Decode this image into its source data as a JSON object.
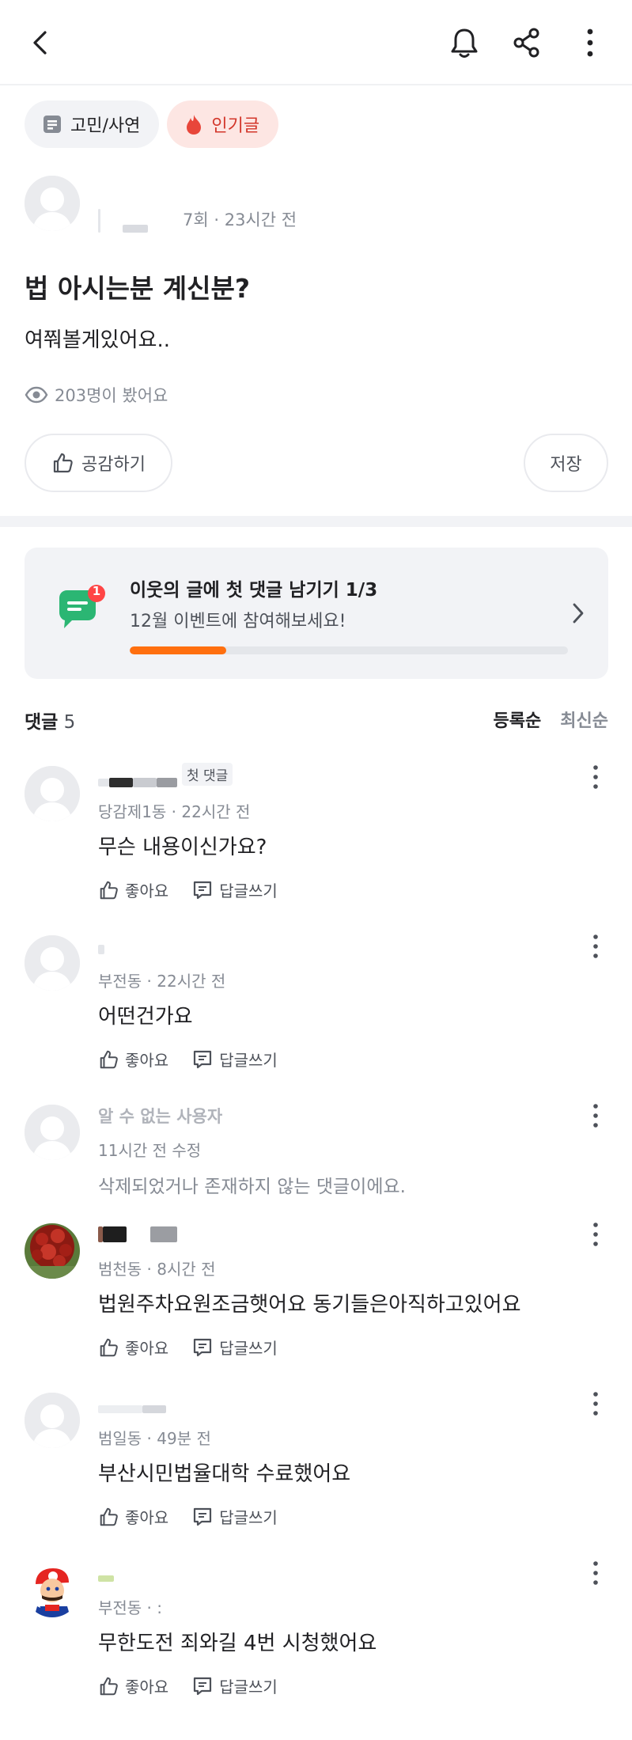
{
  "header": {
    "back_icon": "chevron-left-icon",
    "bell_icon": "bell-icon",
    "share_icon": "share-icon",
    "more_icon": "more-vertical-icon"
  },
  "chips": {
    "category": "고민/사연",
    "popular": "인기글"
  },
  "post": {
    "author_meta": "7회 · 23시간 전",
    "title": "법 아시는분 계신분?",
    "body": "여쭤볼게있어요..",
    "views": "203명이 봤어요",
    "like_button": "공감하기",
    "save_button": "저장"
  },
  "event": {
    "badge": "1",
    "title": "이웃의 글에 첫 댓글 남기기 1/3",
    "subtitle": "12월 이벤트에 참여해보세요!",
    "progress": 0.22
  },
  "comments_header": {
    "label": "댓글",
    "count": "5",
    "sort_registered": "등록순",
    "sort_latest": "최신순"
  },
  "comments": [
    {
      "badge": "첫 댓글",
      "meta": "당감제1동 · 22시간 전",
      "text": "무슨 내용이신가요?",
      "like": "좋아요",
      "reply": "답글쓰기"
    },
    {
      "meta": "부전동 · 22시간 전",
      "text": "어떤건가요",
      "like": "좋아요",
      "reply": "답글쓰기"
    },
    {
      "name": "알 수 없는 사용자",
      "meta": "11시간 전 수정",
      "text": "삭제되었거나 존재하지 않는 댓글이에요."
    },
    {
      "meta": "범천동 · 8시간 전",
      "text": "법원주차요원조금햇어요 동기들은아직하고있어요",
      "like": "좋아요",
      "reply": "답글쓰기"
    },
    {
      "meta": "범일동 · 49분 전",
      "text": "부산시민법율대학 수료했어요",
      "like": "좋아요",
      "reply": "답글쓰기"
    },
    {
      "meta": "부전동 · :",
      "text": "무한도전 죄와길 4번 시청했어요",
      "like": "좋아요",
      "reply": "답글쓰기"
    }
  ],
  "colors": {
    "accent_orange": "#ff6f0f",
    "popular_red": "#d3372b",
    "event_green": "#2bb673",
    "text_primary": "#212124",
    "text_secondary": "#868b94"
  }
}
